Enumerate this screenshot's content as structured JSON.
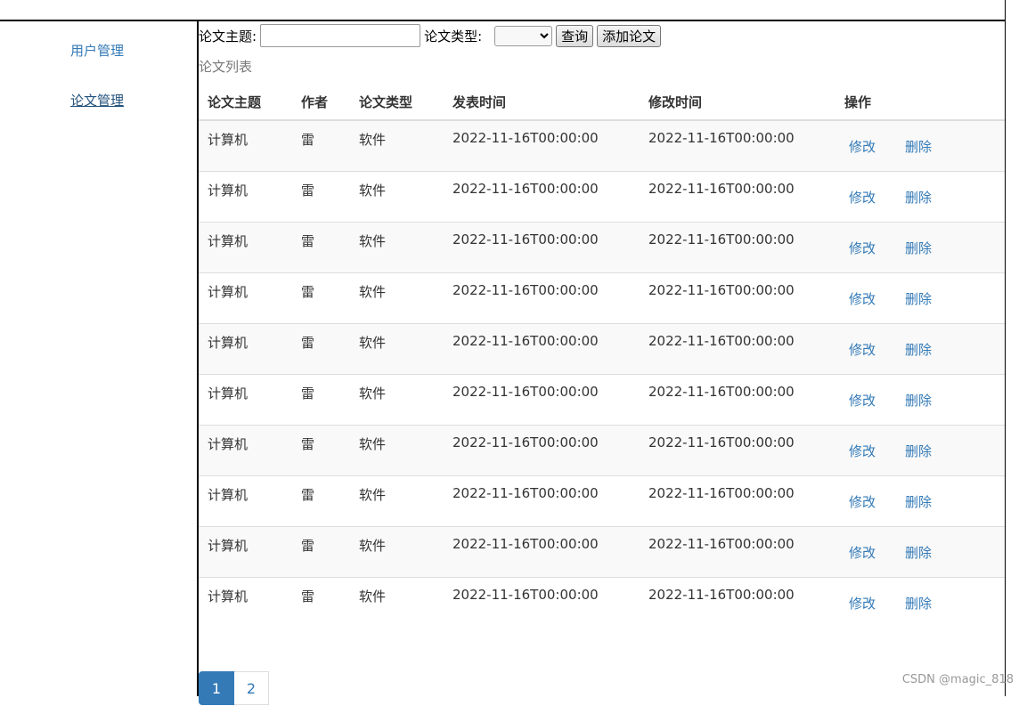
{
  "sidebar": {
    "items": [
      {
        "label": "用户管理"
      },
      {
        "label": "论文管理"
      }
    ]
  },
  "search": {
    "topic_label": "论文主题:",
    "topic_value": "",
    "type_label": "论文类型:",
    "type_selected": "",
    "query_button": "查询",
    "add_button": "添加论文"
  },
  "list_caption": "论文列表",
  "table": {
    "headers": [
      "论文主题",
      "作者",
      "论文类型",
      "发表时间",
      "修改时间",
      "操作"
    ],
    "rows": [
      [
        "计算机",
        "雷",
        "软件",
        "2022-11-16T00:00:00",
        "2022-11-16T00:00:00"
      ],
      [
        "计算机",
        "雷",
        "软件",
        "2022-11-16T00:00:00",
        "2022-11-16T00:00:00"
      ],
      [
        "计算机",
        "雷",
        "软件",
        "2022-11-16T00:00:00",
        "2022-11-16T00:00:00"
      ],
      [
        "计算机",
        "雷",
        "软件",
        "2022-11-16T00:00:00",
        "2022-11-16T00:00:00"
      ],
      [
        "计算机",
        "雷",
        "软件",
        "2022-11-16T00:00:00",
        "2022-11-16T00:00:00"
      ],
      [
        "计算机",
        "雷",
        "软件",
        "2022-11-16T00:00:00",
        "2022-11-16T00:00:00"
      ],
      [
        "计算机",
        "雷",
        "软件",
        "2022-11-16T00:00:00",
        "2022-11-16T00:00:00"
      ],
      [
        "计算机",
        "雷",
        "软件",
        "2022-11-16T00:00:00",
        "2022-11-16T00:00:00"
      ],
      [
        "计算机",
        "雷",
        "软件",
        "2022-11-16T00:00:00",
        "2022-11-16T00:00:00"
      ],
      [
        "计算机",
        "雷",
        "软件",
        "2022-11-16T00:00:00",
        "2022-11-16T00:00:00"
      ]
    ],
    "edit_label": "修改",
    "delete_label": "删除"
  },
  "pagination": {
    "pages": [
      "1",
      "2"
    ],
    "current": "1"
  },
  "watermark": "CSDN @magic_818",
  "colors": {
    "link": "#337ab7",
    "active_page_bg": "#337ab7",
    "stripe": "#f9f9f9"
  }
}
